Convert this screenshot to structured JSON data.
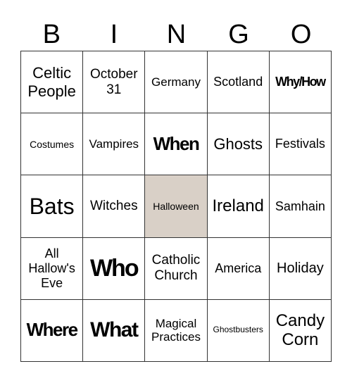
{
  "header": [
    "B",
    "I",
    "N",
    "G",
    "O"
  ],
  "colors": {
    "free_space": "#d9d0c7",
    "grid_line": "#333333"
  },
  "cells": [
    [
      "Celtic People",
      "October 31",
      "Germany",
      "Scotland",
      "Why/How"
    ],
    [
      "Costumes",
      "Vampires",
      "When",
      "Ghosts",
      "Festivals"
    ],
    [
      "Bats",
      "Witches",
      "Halloween",
      "Ireland",
      "Samhain"
    ],
    [
      "All Hallow's Eve",
      "Who",
      "Catholic Church",
      "America",
      "Holiday"
    ],
    [
      "Where",
      "What",
      "Magical Practices",
      "Ghostbusters",
      "Candy Corn"
    ]
  ],
  "free_space": "Halloween"
}
